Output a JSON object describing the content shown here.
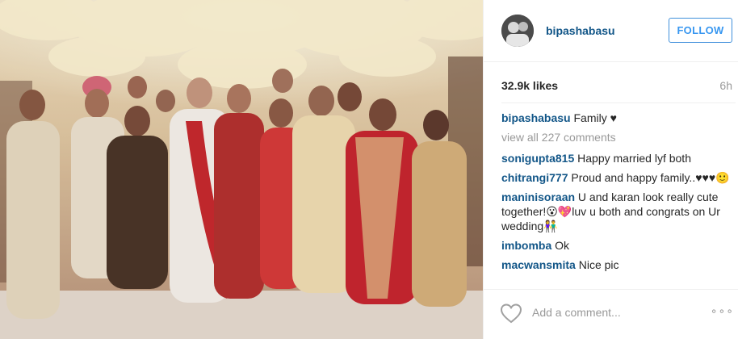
{
  "post": {
    "photo_alt": "Family"
  },
  "header": {
    "username": "bipashabasu",
    "follow_label": "FOLLOW"
  },
  "stats": {
    "likes": "32.9k likes",
    "time": "6h"
  },
  "caption": {
    "user": "bipashabasu",
    "text": "Family ♥"
  },
  "view_all": "view all 227 comments",
  "comments": [
    {
      "user": "sonigupta815",
      "text": "Happy married lyf both"
    },
    {
      "user": "chitrangi777",
      "text": "Proud and happy family..♥♥♥🙂"
    },
    {
      "user": "maninisoraan",
      "text": "U and karan look really cute together!😮💖luv u both and congrats on Ur wedding👫"
    },
    {
      "user": "imbomba",
      "text": "Ok"
    },
    {
      "user": "macwansmita",
      "text": "Nice pic"
    }
  ],
  "footer": {
    "add_comment_placeholder": "Add a comment...",
    "more_label": "∘∘∘",
    "heart_icon": "heart-outline-icon"
  },
  "colors": {
    "link": "#125688",
    "follow": "#3897f0",
    "muted": "#999999"
  }
}
